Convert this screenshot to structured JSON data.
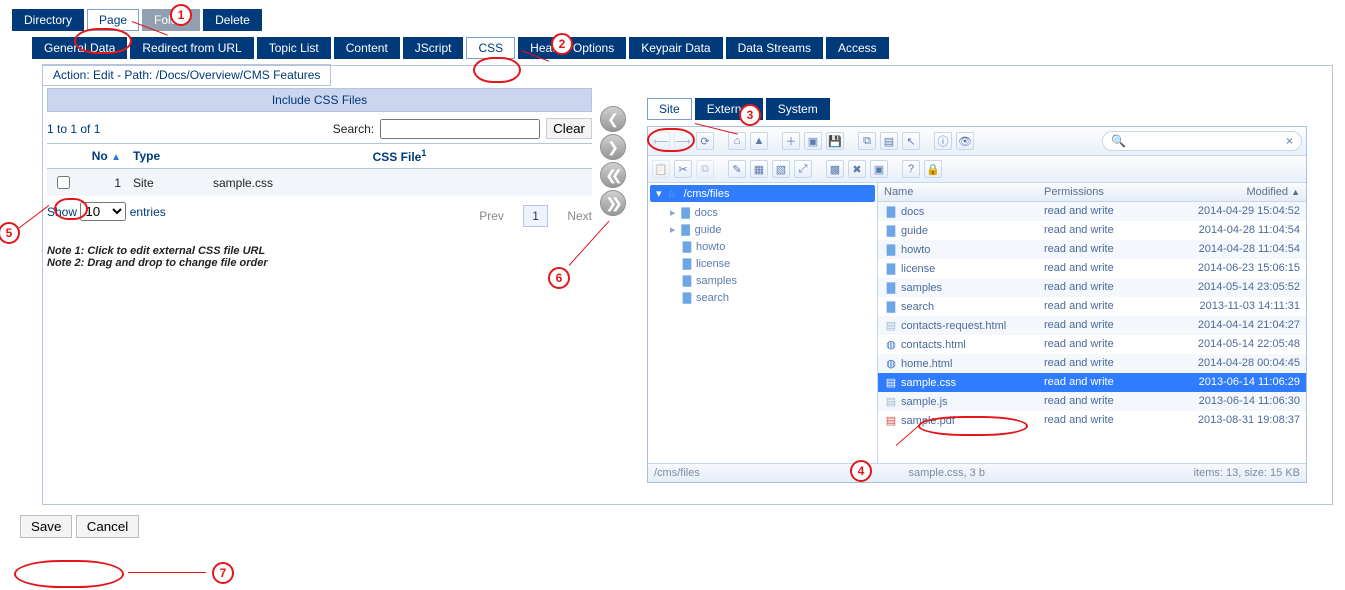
{
  "topTabs": {
    "directory": "Directory",
    "page": "Page",
    "folder": "Folder",
    "delete": "Delete"
  },
  "subTabs": {
    "general": "General Data",
    "redirect": "Redirect from URL",
    "topic": "Topic List",
    "content": "Content",
    "jscript": "JScript",
    "css": "CSS",
    "header": "Header Options",
    "keypair": "Keypair Data",
    "streams": "Data Streams",
    "access": "Access"
  },
  "pathBar": "Action: Edit - Path: /Docs/Overview/CMS Features",
  "sectionHeading": "Include CSS Files",
  "countLabel": "1 to 1 of 1",
  "searchLabel": "Search:",
  "clearLabel": "Clear",
  "cols": {
    "no": "No",
    "type": "Type",
    "file": "CSS File",
    "fileSup": "1"
  },
  "row1": {
    "no": "1",
    "type": "Site",
    "file": "sample.css"
  },
  "showRow": {
    "show": "Show",
    "count": "10",
    "entries": "entries"
  },
  "pager": {
    "prev": "Prev",
    "page": "1",
    "next": "Next"
  },
  "notes": {
    "n1": "Note 1: Click to edit external CSS file URL",
    "n2": "Note 2: Drag and drop to change file order"
  },
  "siteTabs": {
    "site": "Site",
    "external": "External",
    "system": "System"
  },
  "searchClear": "×",
  "tree": {
    "root": "/cms/files",
    "items": [
      "docs",
      "guide",
      "howto",
      "license",
      "samples",
      "search"
    ]
  },
  "fileCols": {
    "name": "Name",
    "perm": "Permissions",
    "mod": "Modified"
  },
  "files": [
    {
      "n": "docs",
      "t": "folder",
      "p": "read and write",
      "m": "2014-04-29 15:04:52"
    },
    {
      "n": "guide",
      "t": "folder",
      "p": "read and write",
      "m": "2014-04-28 11:04:54"
    },
    {
      "n": "howto",
      "t": "folder",
      "p": "read and write",
      "m": "2014-04-28 11:04:54"
    },
    {
      "n": "license",
      "t": "folder",
      "p": "read and write",
      "m": "2014-06-23 15:06:15"
    },
    {
      "n": "samples",
      "t": "folder",
      "p": "read and write",
      "m": "2014-05-14 23:05:52"
    },
    {
      "n": "search",
      "t": "folder",
      "p": "read and write",
      "m": "2013-11-03 14:11:31"
    },
    {
      "n": "contacts-request.html",
      "t": "html",
      "p": "read and write",
      "m": "2014-04-14 21:04:27"
    },
    {
      "n": "contacts.html",
      "t": "globe",
      "p": "read and write",
      "m": "2014-05-14 22:05:48"
    },
    {
      "n": "home.html",
      "t": "globe",
      "p": "read and write",
      "m": "2014-04-28 00:04:45"
    },
    {
      "n": "sample.css",
      "t": "css",
      "p": "read and write",
      "m": "2013-06-14 11:06:29",
      "sel": true
    },
    {
      "n": "sample.js",
      "t": "js",
      "p": "read and write",
      "m": "2013-06-14 11:06:30"
    },
    {
      "n": "sample.pdf",
      "t": "pdf",
      "p": "read and write",
      "m": "2013-08-31 19:08:37"
    }
  ],
  "status": {
    "path": "/cms/files",
    "sel": "sample.css, 3 b",
    "summary": "items: 13, size: 15 KB"
  },
  "buttons": {
    "save": "Save",
    "cancel": "Cancel"
  },
  "callouts": {
    "1": "1",
    "2": "2",
    "3": "3",
    "4": "4",
    "5": "5",
    "6": "6",
    "7": "7"
  }
}
